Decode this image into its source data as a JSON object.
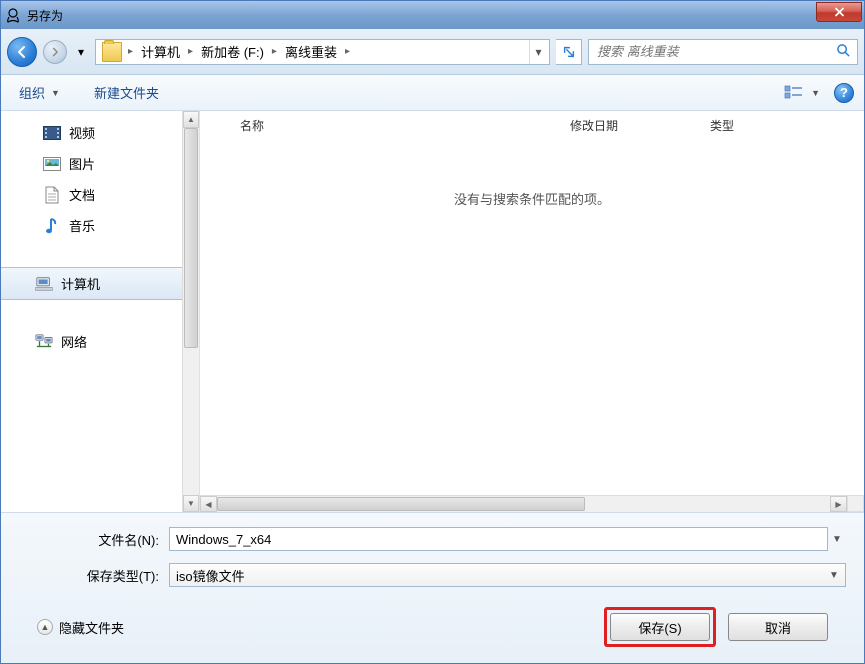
{
  "window": {
    "title": "另存为"
  },
  "address": {
    "segments": [
      "计算机",
      "新加卷 (F:)",
      "离线重装"
    ]
  },
  "search": {
    "placeholder": "搜索 离线重装"
  },
  "toolbar": {
    "organize": "组织",
    "new_folder": "新建文件夹"
  },
  "sidebar": {
    "video": "视频",
    "pictures": "图片",
    "documents": "文档",
    "music": "音乐",
    "computer": "计算机",
    "network": "网络"
  },
  "columns": {
    "name": "名称",
    "date": "修改日期",
    "type": "类型"
  },
  "content": {
    "empty": "没有与搜索条件匹配的项。"
  },
  "form": {
    "filename_label": "文件名(N):",
    "filename_value": "Windows_7_x64",
    "filetype_label": "保存类型(T):",
    "filetype_value": "iso镜像文件"
  },
  "footer": {
    "hide_folders": "隐藏文件夹",
    "save": "保存(S)",
    "cancel": "取消"
  }
}
